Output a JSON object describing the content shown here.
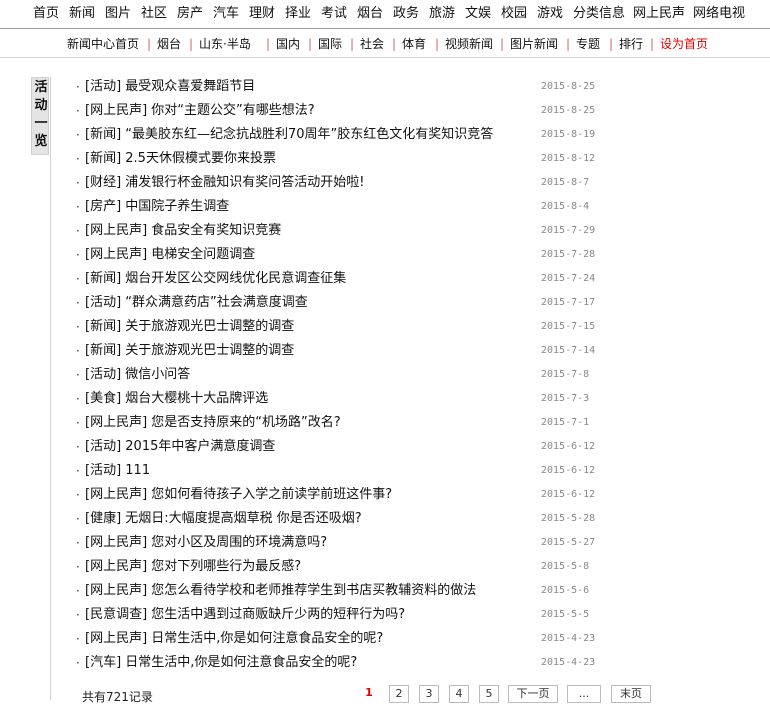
{
  "top_nav": [
    "首页",
    "新闻",
    "图片",
    "社区",
    "房产",
    "汽车",
    "理财",
    "择业",
    "考试",
    "烟台",
    "政务",
    "旅游",
    "文娱",
    "校园",
    "游戏",
    "分类信息",
    "网上民声",
    "网络电视"
  ],
  "sub_nav": [
    "新闻中心首页",
    "烟台",
    "山东·半岛",
    "国内",
    "国际",
    "社会",
    "体育",
    "视频新闻",
    "图片新闻",
    "专题",
    "排行",
    "设为首页"
  ],
  "side_tab": {
    "chars": [
      "活",
      "动",
      "一",
      "览"
    ]
  },
  "list": [
    {
      "title": "[活动] 最受观众喜爱舞蹈节目",
      "date": "2015-8-25"
    },
    {
      "title": "[网上民声] 你对“主题公交”有哪些想法?",
      "date": "2015-8-25"
    },
    {
      "title": "[新闻] “最美胶东红—纪念抗战胜利70周年”胶东红色文化有奖知识竞答",
      "date": "2015-8-19"
    },
    {
      "title": "[新闻] 2.5天休假模式要你来投票",
      "date": "2015-8-12"
    },
    {
      "title": "[财经] 浦发银行杯金融知识有奖问答活动开始啦!",
      "date": "2015-8-7"
    },
    {
      "title": "[房产] 中国院子养生调查",
      "date": "2015-8-4"
    },
    {
      "title": "[网上民声] 食品安全有奖知识竞赛",
      "date": "2015-7-29"
    },
    {
      "title": "[网上民声] 电梯安全问题调查",
      "date": "2015-7-28"
    },
    {
      "title": "[新闻] 烟台开发区公交网线优化民意调查征集",
      "date": "2015-7-24"
    },
    {
      "title": "[活动] “群众满意药店”社会满意度调查",
      "date": "2015-7-17"
    },
    {
      "title": "[新闻] 关于旅游观光巴士调整的调查",
      "date": "2015-7-15"
    },
    {
      "title": "[新闻] 关于旅游观光巴士调整的调查",
      "date": "2015-7-14"
    },
    {
      "title": "[活动] 微信小问答",
      "date": "2015-7-8"
    },
    {
      "title": "[美食] 烟台大樱桃十大品牌评选",
      "date": "2015-7-3"
    },
    {
      "title": "[网上民声] 您是否支持原来的“机场路”改名?",
      "date": "2015-7-1"
    },
    {
      "title": "[活动] 2015年中客户满意度调查",
      "date": "2015-6-12"
    },
    {
      "title": "[活动] 111",
      "date": "2015-6-12"
    },
    {
      "title": "[网上民声] 您如何看待孩子入学之前读学前班这件事?",
      "date": "2015-6-12"
    },
    {
      "title": "[健康] 无烟日:大幅度提高烟草税 你是否还吸烟?",
      "date": "2015-5-28"
    },
    {
      "title": "[网上民声] 您对小区及周围的环境满意吗?",
      "date": "2015-5-27"
    },
    {
      "title": "[网上民声] 您对下列哪些行为最反感?",
      "date": "2015-5-8"
    },
    {
      "title": "[网上民声] 您怎么看待学校和老师推荐学生到书店买教辅资料的做法",
      "date": "2015-5-6"
    },
    {
      "title": "[民意调查] 您生活中遇到过商贩缺斤少两的短秤行为吗?",
      "date": "2015-5-5"
    },
    {
      "title": "[网上民声] 日常生活中,你是如何注意食品安全的呢?",
      "date": "2015-4-23"
    },
    {
      "title": "[汽车] 日常生活中,你是如何注意食品安全的呢?",
      "date": "2015-4-23"
    }
  ],
  "pagination": {
    "total_text": "共有721记录",
    "current": "1",
    "pages": [
      "2",
      "3",
      "4",
      "5"
    ],
    "next_label": "下一页",
    "ellipsis": "...",
    "last_label": "末页"
  }
}
